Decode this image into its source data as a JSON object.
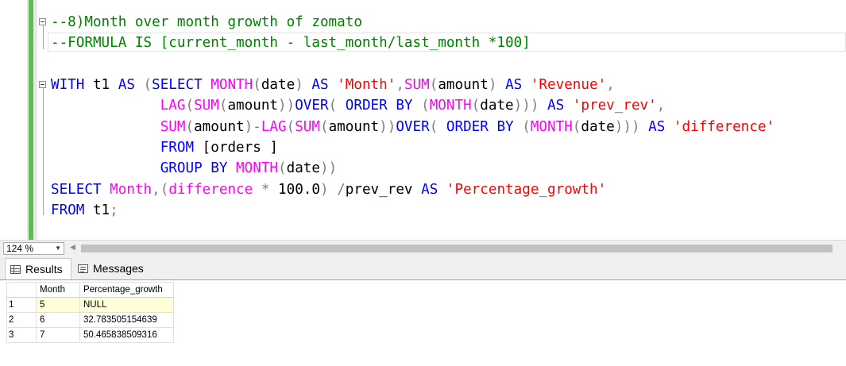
{
  "editor": {
    "lines": [
      [
        {
          "c": "cm",
          "t": "--8)Month over month growth of zomato"
        }
      ],
      [
        {
          "c": "cm",
          "t": "--FORMULA IS [current_month - last_month/last_month *100]"
        }
      ],
      [],
      [
        {
          "c": "kw",
          "t": "WITH"
        },
        {
          "c": "",
          "t": " t1 "
        },
        {
          "c": "kw",
          "t": "AS"
        },
        {
          "c": "",
          "t": " "
        },
        {
          "c": "op",
          "t": "("
        },
        {
          "c": "kw",
          "t": "SELECT"
        },
        {
          "c": "",
          "t": " "
        },
        {
          "c": "fn",
          "t": "MONTH"
        },
        {
          "c": "op",
          "t": "("
        },
        {
          "c": "",
          "t": "date"
        },
        {
          "c": "op",
          "t": ")"
        },
        {
          "c": "",
          "t": " "
        },
        {
          "c": "kw",
          "t": "AS"
        },
        {
          "c": "",
          "t": " "
        },
        {
          "c": "str",
          "t": "'Month'"
        },
        {
          "c": "op",
          "t": ","
        },
        {
          "c": "fn",
          "t": "SUM"
        },
        {
          "c": "op",
          "t": "("
        },
        {
          "c": "",
          "t": "amount"
        },
        {
          "c": "op",
          "t": ")"
        },
        {
          "c": "",
          "t": " "
        },
        {
          "c": "kw",
          "t": "AS"
        },
        {
          "c": "",
          "t": " "
        },
        {
          "c": "str",
          "t": "'Revenue'"
        },
        {
          "c": "op",
          "t": ","
        }
      ],
      [
        {
          "c": "",
          "t": "             "
        },
        {
          "c": "fn",
          "t": "LAG"
        },
        {
          "c": "op",
          "t": "("
        },
        {
          "c": "fn",
          "t": "SUM"
        },
        {
          "c": "op",
          "t": "("
        },
        {
          "c": "",
          "t": "amount"
        },
        {
          "c": "op",
          "t": "))"
        },
        {
          "c": "kw",
          "t": "OVER"
        },
        {
          "c": "op",
          "t": "("
        },
        {
          "c": "",
          "t": " "
        },
        {
          "c": "kw",
          "t": "ORDER BY"
        },
        {
          "c": "",
          "t": " "
        },
        {
          "c": "op",
          "t": "("
        },
        {
          "c": "fn",
          "t": "MONTH"
        },
        {
          "c": "op",
          "t": "("
        },
        {
          "c": "",
          "t": "date"
        },
        {
          "c": "op",
          "t": ")))"
        },
        {
          "c": "",
          "t": " "
        },
        {
          "c": "kw",
          "t": "AS"
        },
        {
          "c": "",
          "t": " "
        },
        {
          "c": "str",
          "t": "'prev_rev'"
        },
        {
          "c": "op",
          "t": ","
        }
      ],
      [
        {
          "c": "",
          "t": "             "
        },
        {
          "c": "fn",
          "t": "SUM"
        },
        {
          "c": "op",
          "t": "("
        },
        {
          "c": "",
          "t": "amount"
        },
        {
          "c": "op",
          "t": ")-"
        },
        {
          "c": "fn",
          "t": "LAG"
        },
        {
          "c": "op",
          "t": "("
        },
        {
          "c": "fn",
          "t": "SUM"
        },
        {
          "c": "op",
          "t": "("
        },
        {
          "c": "",
          "t": "amount"
        },
        {
          "c": "op",
          "t": "))"
        },
        {
          "c": "kw",
          "t": "OVER"
        },
        {
          "c": "op",
          "t": "("
        },
        {
          "c": "",
          "t": " "
        },
        {
          "c": "kw",
          "t": "ORDER BY"
        },
        {
          "c": "",
          "t": " "
        },
        {
          "c": "op",
          "t": "("
        },
        {
          "c": "fn",
          "t": "MONTH"
        },
        {
          "c": "op",
          "t": "("
        },
        {
          "c": "",
          "t": "date"
        },
        {
          "c": "op",
          "t": ")))"
        },
        {
          "c": "",
          "t": " "
        },
        {
          "c": "kw",
          "t": "AS"
        },
        {
          "c": "",
          "t": " "
        },
        {
          "c": "str",
          "t": "'difference'"
        }
      ],
      [
        {
          "c": "",
          "t": "             "
        },
        {
          "c": "kw",
          "t": "FROM"
        },
        {
          "c": "",
          "t": " [orders ]"
        }
      ],
      [
        {
          "c": "",
          "t": "             "
        },
        {
          "c": "kw",
          "t": "GROUP BY"
        },
        {
          "c": "",
          "t": " "
        },
        {
          "c": "fn",
          "t": "MONTH"
        },
        {
          "c": "op",
          "t": "("
        },
        {
          "c": "",
          "t": "date"
        },
        {
          "c": "op",
          "t": "))"
        }
      ],
      [
        {
          "c": "kw",
          "t": "SELECT"
        },
        {
          "c": "",
          "t": " "
        },
        {
          "c": "fn",
          "t": "Month"
        },
        {
          "c": "op",
          "t": ",("
        },
        {
          "c": "fn",
          "t": "difference"
        },
        {
          "c": "",
          "t": " "
        },
        {
          "c": "op",
          "t": "*"
        },
        {
          "c": "",
          "t": " 100.0"
        },
        {
          "c": "op",
          "t": ")"
        },
        {
          "c": "",
          "t": " "
        },
        {
          "c": "op",
          "t": "/"
        },
        {
          "c": "",
          "t": "prev_rev "
        },
        {
          "c": "kw",
          "t": "AS"
        },
        {
          "c": "",
          "t": " "
        },
        {
          "c": "str",
          "t": "'Percentage_growth'"
        }
      ],
      [
        {
          "c": "kw",
          "t": "FROM"
        },
        {
          "c": "",
          "t": " t1"
        },
        {
          "c": "op",
          "t": ";"
        }
      ]
    ]
  },
  "statusbar": {
    "zoom": "124 %",
    "zoom_icon": "chevron-down-icon",
    "scroll_left_icon": "triangle-left-icon"
  },
  "tabs": {
    "results_label": "Results",
    "results_icon": "grid-icon",
    "messages_label": "Messages",
    "messages_icon": "messages-icon"
  },
  "results": {
    "columns": [
      "Month",
      "Percentage_growth"
    ],
    "rows": [
      {
        "n": "1",
        "month": "5",
        "pg": "NULL"
      },
      {
        "n": "2",
        "month": "6",
        "pg": "32.783505154639"
      },
      {
        "n": "3",
        "month": "7",
        "pg": "50.465838509316"
      }
    ]
  },
  "colors": {
    "comment": "#008000",
    "keyword": "#0000ff",
    "function": "#ff00ff",
    "string": "#ff0000",
    "operator": "#808080",
    "change_bar": "#5dbd55",
    "null_cell": "#ffffd7"
  }
}
